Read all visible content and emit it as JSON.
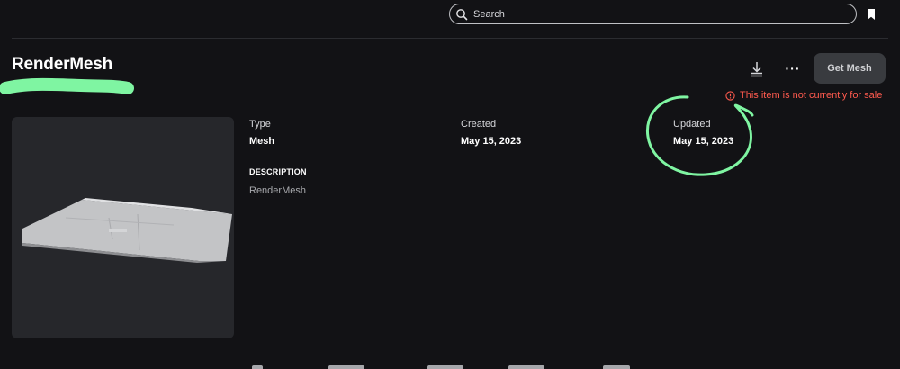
{
  "search": {
    "placeholder": "Search"
  },
  "item": {
    "title": "RenderMesh",
    "get_label": "Get Mesh",
    "more_label": "···",
    "sale_notice": "This item is not currently for sale"
  },
  "details": {
    "type_label": "Type",
    "type_value": "Mesh",
    "created_label": "Created",
    "created_value": "May 15, 2023",
    "updated_label": "Updated",
    "updated_value": "May 15, 2023",
    "description_heading": "DESCRIPTION",
    "description_text": "RenderMesh"
  },
  "colors": {
    "background": "#121215",
    "button": "#393b3f",
    "warning": "#ff5a4e",
    "annotation": "#7ff5a2",
    "thumbnail_bg": "#26272b"
  },
  "icons": [
    "search-icon",
    "bookmark-icon",
    "download-icon",
    "more-icon",
    "warning-icon"
  ]
}
